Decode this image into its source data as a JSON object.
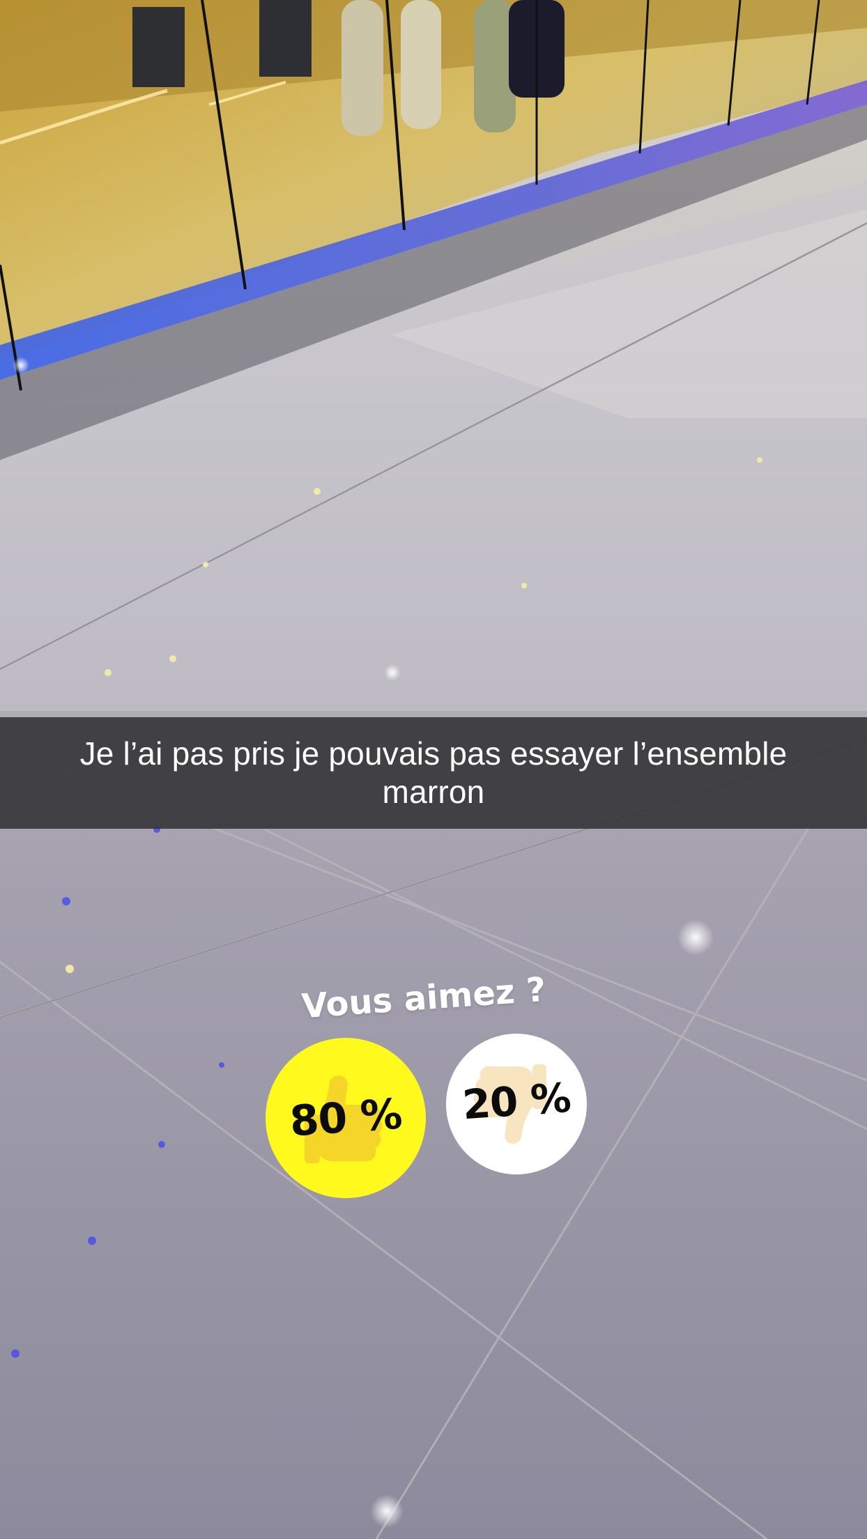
{
  "caption": {
    "text": "Je l’ai pas pris je pouvais pas essayer l’ensemble marron"
  },
  "poll": {
    "question": "Vous aimez ?",
    "options": [
      {
        "icon": "thumbs-up-icon",
        "percent_label": "80 %",
        "share": 0.8,
        "color": "#fff91e"
      },
      {
        "icon": "thumbs-down-icon",
        "percent_label": "20 %",
        "share": 0.2,
        "color": "#ffffff"
      }
    ]
  }
}
